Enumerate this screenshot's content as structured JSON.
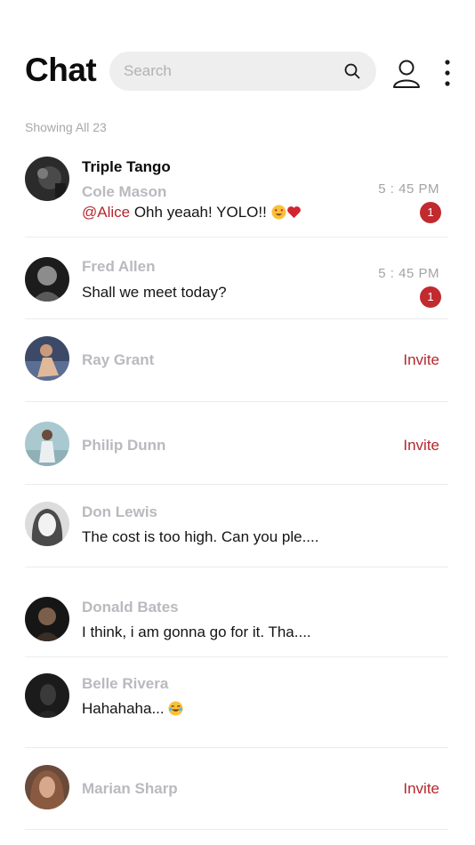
{
  "header": {
    "title": "Chat",
    "search_placeholder": "Search"
  },
  "list_info": "Showing All 23",
  "conversations": [
    {
      "group": "Triple Tango",
      "name": "Cole Mason",
      "mention": "@Alice",
      "message": " Ohh yeaah! YOLO!!",
      "emojis": [
        "heart-eyes-emoji",
        "red-heart-emoji"
      ],
      "time": "5 : 45 PM",
      "unread": "1"
    },
    {
      "name": "Fred Allen",
      "message": "Shall we meet today?",
      "time": "5 : 45 PM",
      "unread": "1"
    },
    {
      "name": "Ray Grant",
      "action": "Invite"
    },
    {
      "name": "Philip Dunn",
      "action": "Invite"
    },
    {
      "name": "Don Lewis",
      "message": "The cost is too high. Can you ple...."
    },
    {
      "name": "Donald Bates",
      "message": "I think, i am gonna go for it. Tha...."
    },
    {
      "name": "Belle Rivera",
      "message": "Hahahaha...",
      "emojis": [
        "laughing-tears-emoji"
      ]
    },
    {
      "name": "Marian Sharp",
      "action": "Invite"
    }
  ],
  "colors": {
    "accent": "#b5262e",
    "badge": "#c12a2e",
    "muted_name": "#b9b9bf",
    "search_bg": "#eeeeee"
  },
  "icons": [
    "search-icon",
    "user-icon",
    "more-vertical-icon"
  ]
}
